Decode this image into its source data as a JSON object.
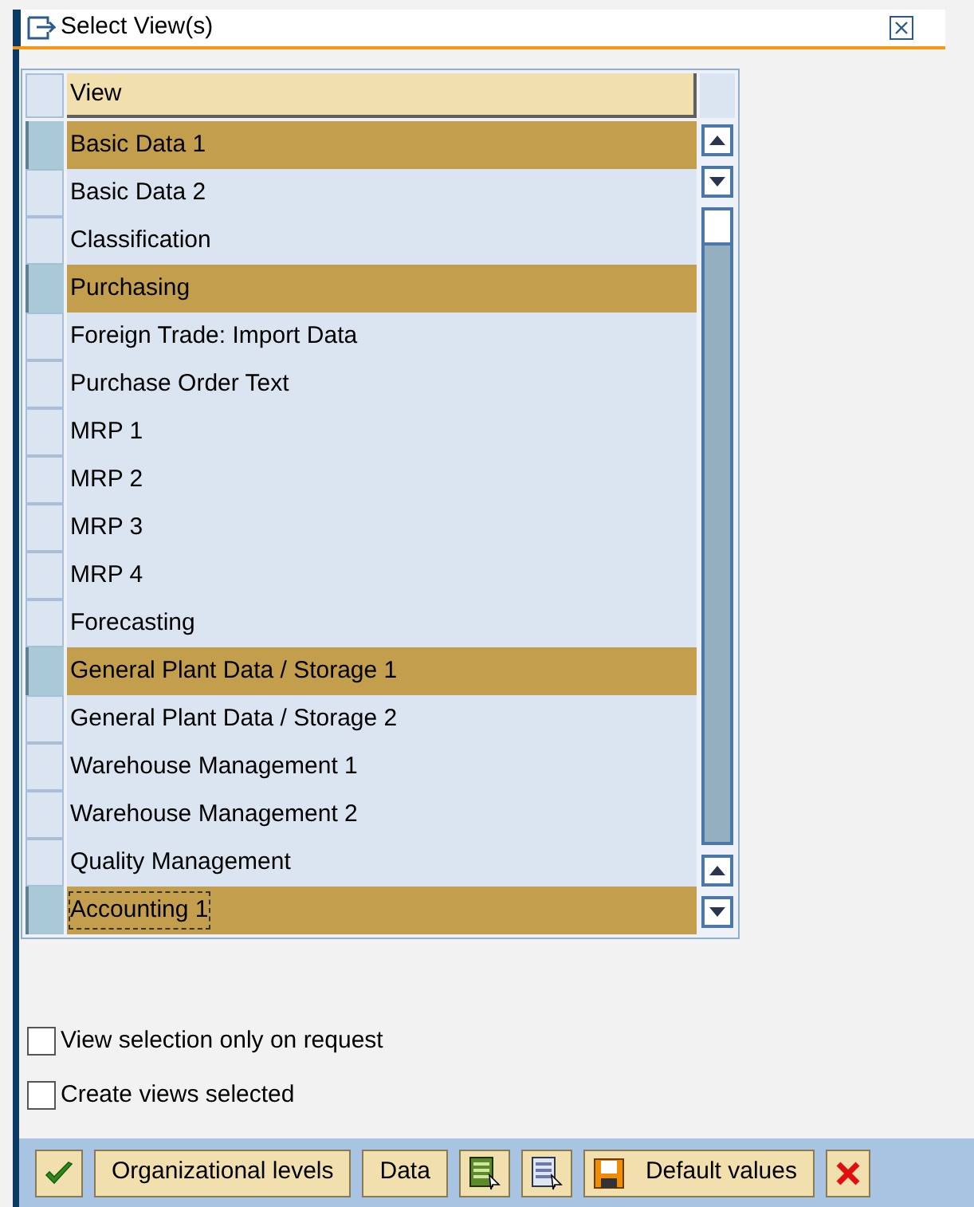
{
  "window": {
    "title": "Select View(s)"
  },
  "table": {
    "columns": [
      "View"
    ],
    "rows": [
      {
        "view": "Basic Data 1",
        "selected": true,
        "focused": false
      },
      {
        "view": "Basic Data 2",
        "selected": false,
        "focused": false
      },
      {
        "view": "Classification",
        "selected": false,
        "focused": false
      },
      {
        "view": "Purchasing",
        "selected": true,
        "focused": false
      },
      {
        "view": "Foreign Trade: Import Data",
        "selected": false,
        "focused": false
      },
      {
        "view": "Purchase Order Text",
        "selected": false,
        "focused": false
      },
      {
        "view": "MRP 1",
        "selected": false,
        "focused": false
      },
      {
        "view": "MRP 2",
        "selected": false,
        "focused": false
      },
      {
        "view": "MRP 3",
        "selected": false,
        "focused": false
      },
      {
        "view": "MRP 4",
        "selected": false,
        "focused": false
      },
      {
        "view": "Forecasting",
        "selected": false,
        "focused": false
      },
      {
        "view": "General Plant Data / Storage 1",
        "selected": true,
        "focused": false
      },
      {
        "view": "General Plant Data / Storage 2",
        "selected": false,
        "focused": false
      },
      {
        "view": "Warehouse Management 1",
        "selected": false,
        "focused": false
      },
      {
        "view": "Warehouse Management 2",
        "selected": false,
        "focused": false
      },
      {
        "view": "Quality Management",
        "selected": false,
        "focused": false
      },
      {
        "view": "Accounting 1",
        "selected": true,
        "focused": true
      }
    ]
  },
  "options": [
    {
      "label": "View selection only on request",
      "checked": false
    },
    {
      "label": "Create views selected",
      "checked": false
    }
  ],
  "toolbar": [
    {
      "kind": "check"
    },
    {
      "kind": "text",
      "label": "Organizational levels"
    },
    {
      "kind": "text",
      "label": "Data"
    },
    {
      "kind": "select-all"
    },
    {
      "kind": "deselect-all"
    },
    {
      "kind": "save",
      "label": "Default values"
    },
    {
      "kind": "cancel"
    }
  ]
}
